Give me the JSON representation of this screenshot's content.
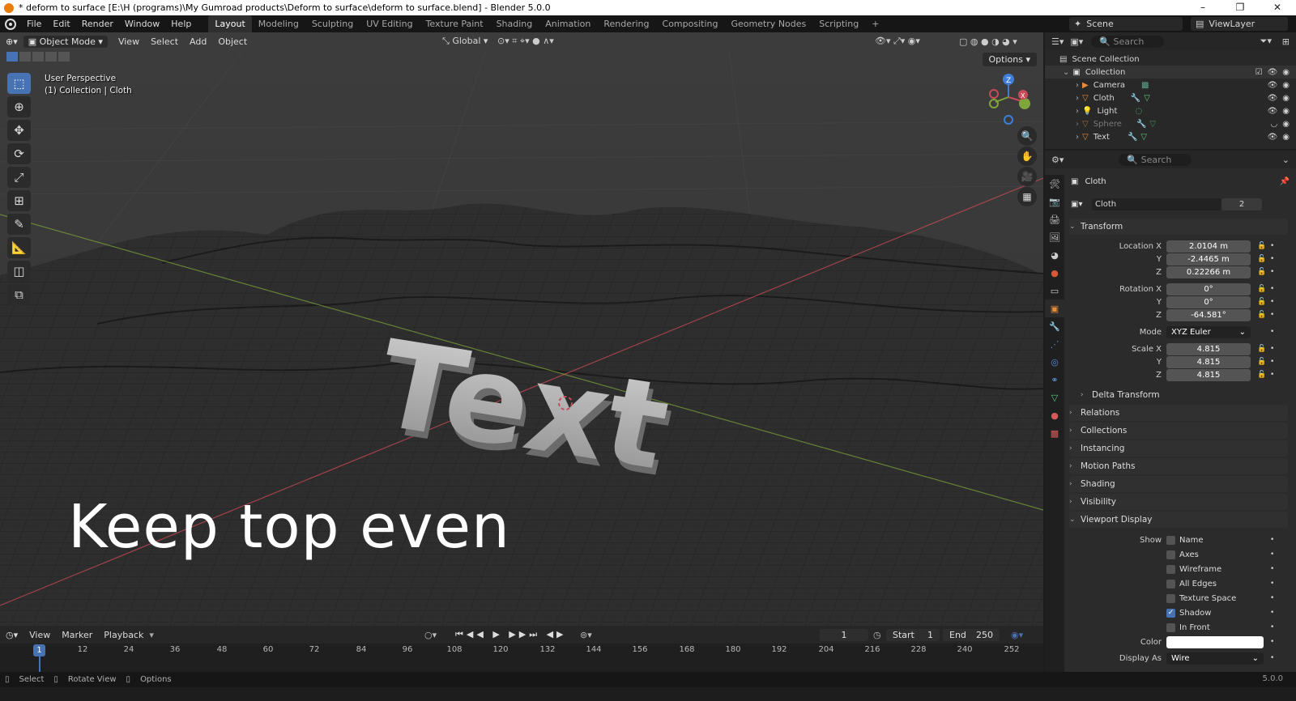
{
  "window": {
    "title": "* deform to surface [E:\\H (programs)\\My Gumroad products\\Deform to surface\\deform to surface.blend] - Blender 5.0.0",
    "controls": [
      "–",
      "❐",
      "✕"
    ]
  },
  "menu": [
    "File",
    "Edit",
    "Render",
    "Window",
    "Help"
  ],
  "workspaces": [
    {
      "label": "Layout",
      "active": true
    },
    {
      "label": "Modeling"
    },
    {
      "label": "Sculpting"
    },
    {
      "label": "UV Editing"
    },
    {
      "label": "Texture Paint"
    },
    {
      "label": "Shading"
    },
    {
      "label": "Animation"
    },
    {
      "label": "Rendering"
    },
    {
      "label": "Compositing"
    },
    {
      "label": "Geometry Nodes"
    },
    {
      "label": "Scripting"
    }
  ],
  "add_workspace": "+",
  "scene": {
    "label": "Scene"
  },
  "view_layer": {
    "label": "ViewLayer"
  },
  "viewport": {
    "mode": "Object Mode",
    "menus": [
      "View",
      "Select",
      "Add",
      "Object"
    ],
    "transform_orientation": "Global",
    "options": "Options",
    "info_line1": "User Perspective",
    "info_line2": "(1) Collection | Cloth",
    "caption": "Keep top even",
    "object_text": "Text",
    "gizmo": {
      "z": "Z",
      "x": "X",
      "y": "Y"
    }
  },
  "timeline": {
    "menus": [
      "View",
      "Marker",
      "Playback"
    ],
    "current_frame": "1",
    "start_label": "Start",
    "start_value": "1",
    "end_label": "End",
    "end_value": "250",
    "ticks": [
      "1",
      "12",
      "24",
      "36",
      "48",
      "60",
      "72",
      "84",
      "96",
      "108",
      "120",
      "132",
      "144",
      "156",
      "168",
      "180",
      "192",
      "204",
      "216",
      "228",
      "240",
      "252"
    ]
  },
  "statusbar": {
    "items": [
      "Select",
      "Rotate View",
      "Options"
    ],
    "version": "5.0.0"
  },
  "outliner": {
    "search_placeholder": "Search",
    "scene_collection": "Scene Collection",
    "collection": "Collection",
    "items": [
      {
        "name": "Camera",
        "color": "#e88b3a"
      },
      {
        "name": "Cloth",
        "color": "#e88b3a"
      },
      {
        "name": "Light",
        "color": "#e8b83a"
      },
      {
        "name": "Sphere",
        "color": "#e88b3a",
        "dimmed": true
      },
      {
        "name": "Text",
        "color": "#e88b3a"
      }
    ]
  },
  "properties": {
    "search_placeholder": "Search",
    "object_name": "Cloth",
    "data_name": "Cloth",
    "data_users": "2",
    "transform": {
      "header": "Transform",
      "location_label": "Location X",
      "location": [
        "2.0104 m",
        "-2.4465 m",
        "0.22266 m"
      ],
      "rotation_label": "Rotation X",
      "rotation": [
        "0°",
        "0°",
        "-64.581°"
      ],
      "mode_label": "Mode",
      "mode": "XYZ Euler",
      "scale_label": "Scale X",
      "scale": [
        "4.815",
        "4.815",
        "4.815"
      ],
      "y_label": "Y",
      "z_label": "Z",
      "delta": "Delta Transform"
    },
    "sections": [
      "Relations",
      "Collections",
      "Instancing",
      "Motion Paths",
      "Shading",
      "Visibility"
    ],
    "viewport_display": {
      "header": "Viewport Display",
      "show_label": "Show",
      "options": [
        {
          "label": "Name",
          "checked": false
        },
        {
          "label": "Axes",
          "checked": false
        },
        {
          "label": "Wireframe",
          "checked": false
        },
        {
          "label": "All Edges",
          "checked": false
        },
        {
          "label": "Texture Space",
          "checked": false
        },
        {
          "label": "Shadow",
          "checked": true
        },
        {
          "label": "In Front",
          "checked": false
        }
      ],
      "color_label": "Color",
      "color_value": "#ffffff",
      "display_as_label": "Display As",
      "display_as": "Wire"
    }
  },
  "colors": {
    "accent": "#4772b3",
    "x_axis": "#c94a58",
    "y_axis": "#7fa63a",
    "z_axis": "#3f7ed8"
  }
}
